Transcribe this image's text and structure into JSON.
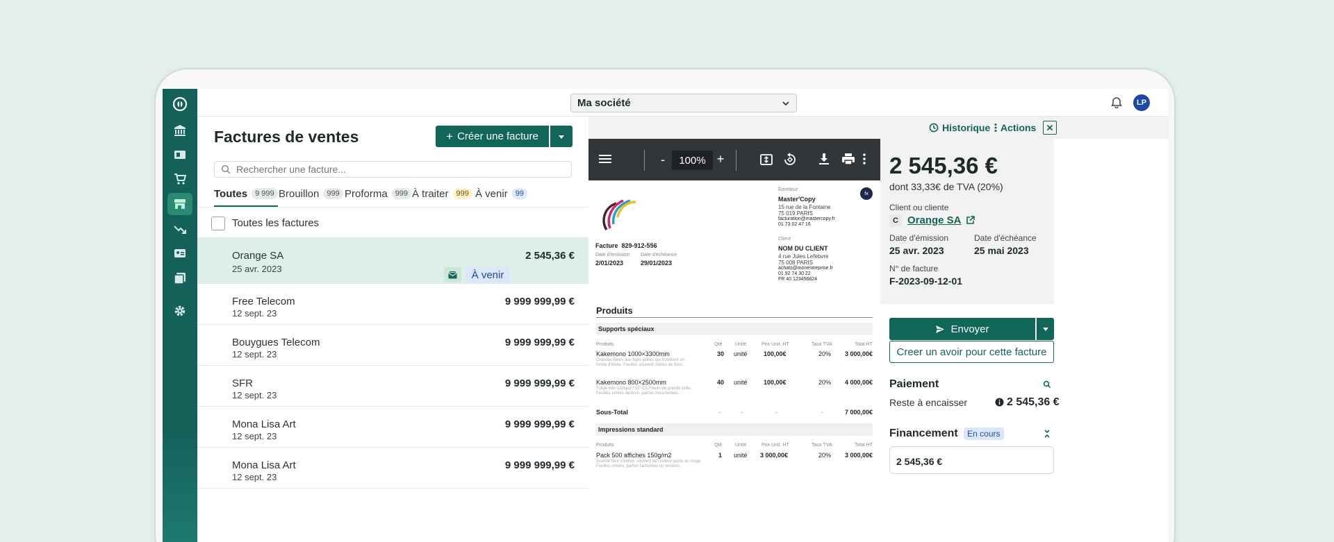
{
  "topbar": {
    "company": "Ma société",
    "avatar": "LP"
  },
  "list": {
    "title": "Factures de ventes",
    "create_label": "Créer une facture",
    "search_placeholder": "Rechercher une facture...",
    "tabs": [
      {
        "label": "Toutes",
        "count": "9 999"
      },
      {
        "label": "Brouillon",
        "count": "999"
      },
      {
        "label": "Proforma",
        "count": "999"
      },
      {
        "label": "À traiter",
        "count": "999"
      },
      {
        "label": "À venir",
        "count": "99"
      }
    ],
    "all_label": "Toutes les factures",
    "rows": [
      {
        "name": "Orange SA",
        "date": "25 avr. 2023",
        "amount": "2 545,36 €",
        "status": "À venir"
      },
      {
        "name": "Free Telecom",
        "date": "12 sept. 23",
        "amount": "9 999 999,99 €"
      },
      {
        "name": "Bouygues Telecom",
        "date": "12 sept. 23",
        "amount": "9 999 999,99 €"
      },
      {
        "name": "SFR",
        "date": "12 sept. 23",
        "amount": "9 999 999,99 €"
      },
      {
        "name": "Mona Lisa Art",
        "date": "12 sept. 23",
        "amount": "9 999 999,99 €"
      },
      {
        "name": "Mona Lisa Art",
        "date": "12 sept. 23",
        "amount": "9 999 999,99 €"
      }
    ]
  },
  "viewer": {
    "zoom": "100%",
    "zoom_minus": "-",
    "zoom_plus": "+",
    "invoice": {
      "emitter_label": "Émetteur",
      "emitter_name": "Master'Copy",
      "emitter_addr1": "15 rue de la Fontaine",
      "emitter_addr2": "75 019 PARIS",
      "emitter_mail": "facturation@mastercopy.fr",
      "emitter_phone": "01 73 02 47 16",
      "badge": "fx",
      "number_label": "Facture",
      "number": "829-912-556",
      "issue_label": "Date d'émission",
      "due_label": "Date d'échéance",
      "issue": "2/01/2023",
      "due": "29/01/2023",
      "client_label": "Client",
      "client_name": "NOM DU CLIENT",
      "client_addr1": "4 rue Jules Lefebvre",
      "client_addr2": "75 008 PARIS",
      "client_mail": "achats@monentreprise.fr",
      "client_phone": "01 92 74 30 22",
      "client_vat": "FR 40 123456824",
      "products_title": "Produits",
      "cols": {
        "product": "Produits",
        "qty": "Qté",
        "unit": "Unité",
        "price": "Prix Unit. HT",
        "vat": "Taux TVA",
        "total": "Total HT"
      },
      "section1": "Supports spéciaux",
      "p1": {
        "name": "Kakemono 1000×3300mm",
        "desc1": "Grandes fleurs aux tiges jaillies qui s'ouvrent en",
        "desc2": "forme d'étoile. Feuilles souvent striées de brun.",
        "qty": "30",
        "unit": "unité",
        "price": "100,00€",
        "vat": "20%",
        "total": "3 000,00€"
      },
      "p2": {
        "name": "Kakemono 800×2500mm",
        "desc1": "Tulipe très rustique / 15 °C). Fleurs de grande taille.",
        "desc2": "Feuilles striées de brun, parfois mouchetées.",
        "qty": "40",
        "unit": "unité",
        "price": "100,00€",
        "vat": "20%",
        "total": "4 000,00€"
      },
      "subtotal_label": "Sous-Total",
      "dash": "-",
      "subtotal": "7 000,00€",
      "section2": "Impressions standard",
      "p3": {
        "name": "Pack 500 affiches 150g/m2",
        "desc1": "Grande fleur colorée, souvent de couleur jaune ou rouge.",
        "desc2": "Feuilles striées, parfois tachetées ou veinées.",
        "qty": "1",
        "unit": "unité",
        "price": "3 000,00€",
        "vat": "20%",
        "total": "3 000,00€"
      }
    }
  },
  "detail": {
    "history": "Historique",
    "actions": "Actions",
    "amount": "2 545,36 €",
    "vat_text": "dont 33,33€ de TVA (20%)",
    "client_label": "Client ou cliente",
    "client_initial": "C",
    "client_name": "Orange SA",
    "issue_label": "Date d'émission",
    "issue": "25 avr. 2023",
    "due_label": "Date d'échéance",
    "due": "25 mai 2023",
    "number_label": "N° de facture",
    "number": "F-2023-09-12-01",
    "send_label": "Envoyer",
    "credit_label": "Creer un avoir pour cette facture",
    "payment_title": "Paiement",
    "remaining_label": "Reste à encaisser",
    "remaining": "2 545,36 €",
    "financing_title": "Financement",
    "financing_status": "En cours",
    "financing_amount": "2 545,36 €"
  },
  "colors": {
    "brand": "#116659",
    "rail": "#14615a",
    "selected_row": "#dcefe8",
    "background": "#e2efec"
  }
}
